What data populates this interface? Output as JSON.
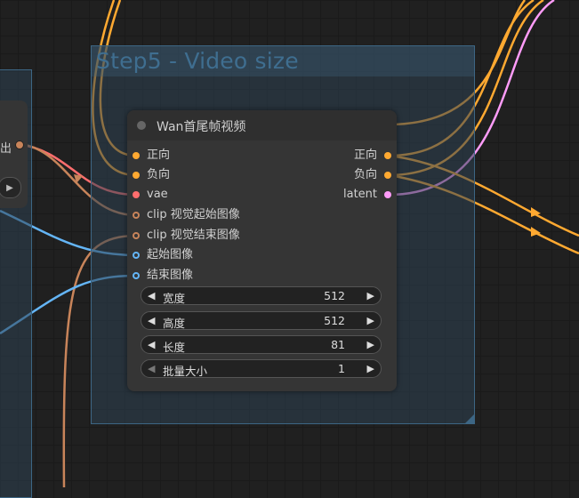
{
  "group": {
    "title": "Step5 - Video size"
  },
  "left_node": {
    "output_label": "出",
    "button_glyph": "▶"
  },
  "node": {
    "title": "Wan首尾帧视频",
    "inputs": [
      {
        "label": "正向",
        "color": "#ffa931",
        "hollow": false
      },
      {
        "label": "负向",
        "color": "#ffa931",
        "hollow": false
      },
      {
        "label": "vae",
        "color": "#ff6e6e",
        "hollow": false
      },
      {
        "label": "clip 视觉起始图像",
        "color": "#c8845a",
        "hollow": true
      },
      {
        "label": "clip 视觉结束图像",
        "color": "#c8845a",
        "hollow": true
      },
      {
        "label": "起始图像",
        "color": "#64b5f6",
        "hollow": true
      },
      {
        "label": "结束图像",
        "color": "#64b5f6",
        "hollow": true
      }
    ],
    "outputs": [
      {
        "label": "正向",
        "color": "#ffa931"
      },
      {
        "label": "负向",
        "color": "#ffa931"
      },
      {
        "label": "latent",
        "color": "#ff9cf9"
      }
    ],
    "widgets": [
      {
        "label": "宽度",
        "value": "512"
      },
      {
        "label": "高度",
        "value": "512"
      },
      {
        "label": "长度",
        "value": "81"
      },
      {
        "label": "批量大小",
        "value": "1"
      }
    ],
    "arrow_left": "◀",
    "arrow_right": "▶"
  },
  "colors": {
    "conditioning": "#ffa931",
    "vae": "#ff6e6e",
    "clip_vision": "#c8845a",
    "image": "#64b5f6",
    "latent": "#ff9cf9"
  }
}
